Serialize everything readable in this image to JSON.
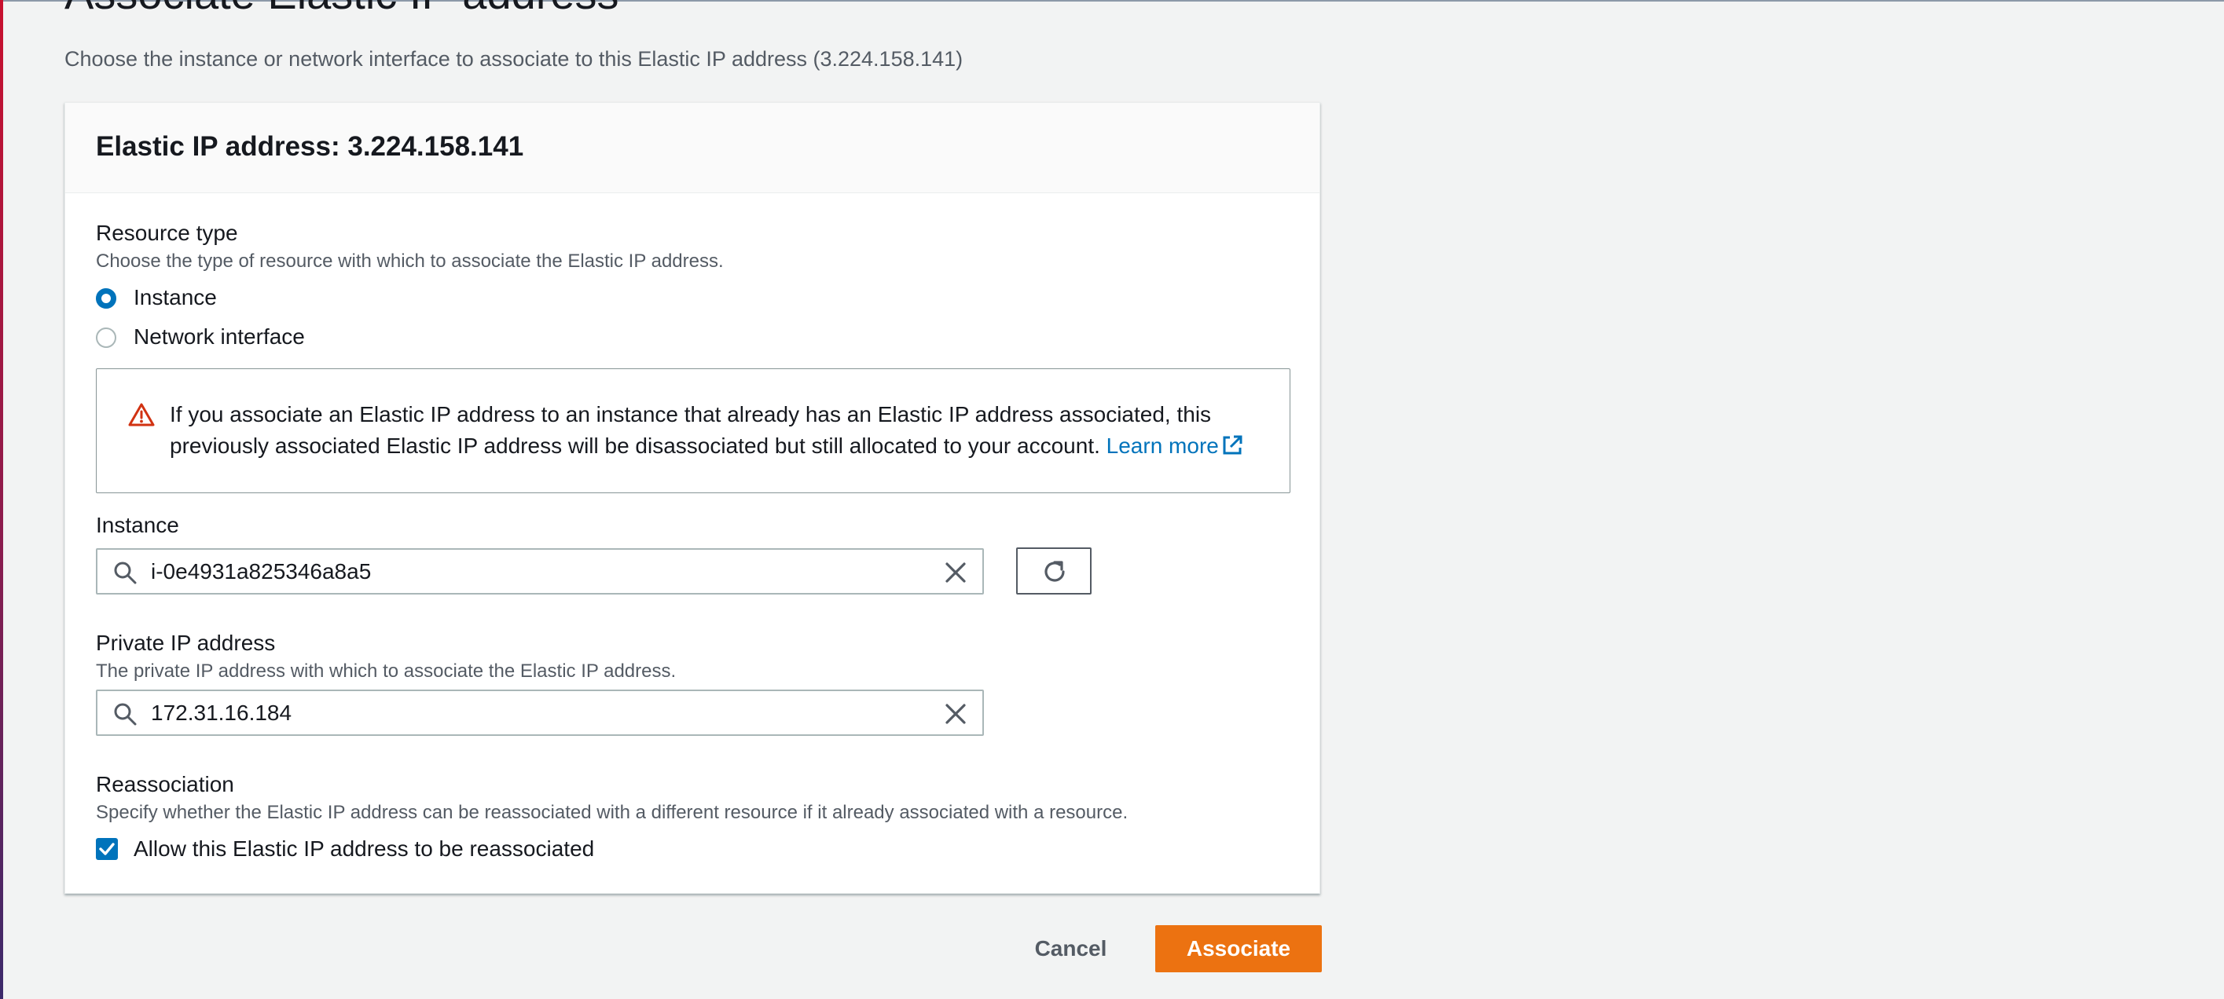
{
  "page": {
    "title": "Associate Elastic IP address",
    "description": "Choose the instance or network interface to associate to this Elastic IP address (3.224.158.141)"
  },
  "panel": {
    "title": "Elastic IP address: 3.224.158.141"
  },
  "resource_type": {
    "label": "Resource type",
    "description": "Choose the type of resource with which to associate the Elastic IP address.",
    "options": [
      {
        "label": "Instance",
        "selected": true
      },
      {
        "label": "Network interface",
        "selected": false
      }
    ]
  },
  "alert": {
    "icon": "warning-icon",
    "text": "If you associate an Elastic IP address to an instance that already has an Elastic IP address associated, this previously associated Elastic IP address will be disassociated but still allocated to your account.",
    "link_label": "Learn more",
    "link_icon": "external-link-icon"
  },
  "instance": {
    "label": "Instance",
    "value": "i-0e4931a825346a8a5",
    "refresh_icon": "refresh-icon"
  },
  "private_ip": {
    "label": "Private IP address",
    "description": "The private IP address with which to associate the Elastic IP address.",
    "value": "172.31.16.184"
  },
  "reassociation": {
    "label": "Reassociation",
    "description": "Specify whether the Elastic IP address can be reassociated with a different resource if it already associated with a resource.",
    "checkbox_label": "Allow this Elastic IP address to be reassociated",
    "checked": true
  },
  "actions": {
    "cancel_label": "Cancel",
    "associate_label": "Associate"
  },
  "colors": {
    "primary_button": "#ec7211",
    "accent_blue": "#0073bb",
    "warning_red": "#d13212"
  }
}
